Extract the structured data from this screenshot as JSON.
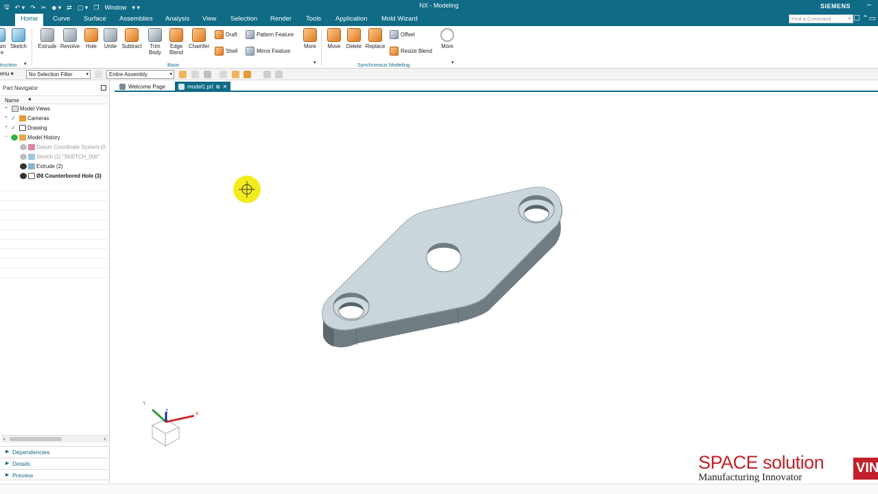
{
  "titlebar": {
    "title": "NX - Modeling",
    "window_label": "Window",
    "brand": "SIEMENS",
    "minimize": "–"
  },
  "menu": {
    "tabs": [
      "Home",
      "Curve",
      "Surface",
      "Assemblies",
      "Analysis",
      "View",
      "Selection",
      "Render",
      "Tools",
      "Application",
      "Mold Wizard"
    ],
    "active": "Home",
    "find_placeholder": "Find a Command"
  },
  "ribbon": {
    "left_partial": [
      "um",
      "e"
    ],
    "sketch": "Sketch",
    "extrude": "Extrude",
    "revolve": "Revolve",
    "hole": "Hole",
    "unite": "Unite",
    "subtract": "Subtract",
    "trim_body": "Trim Body",
    "edge_blend": "Edge Blend",
    "chamfer": "Chamfer",
    "draft": "Draft",
    "shell": "Shell",
    "pattern_feature": "Pattern Feature",
    "mirror_feature": "Mirror Feature",
    "more1": "More",
    "move": "Move",
    "delete": "Delete",
    "replace": "Replace",
    "offset": "Offset",
    "resize_blend": "Resize Blend",
    "more2": "More",
    "group_construction": "truction",
    "group_base": "Base",
    "group_sync": "Synchronous Modeling"
  },
  "selection": {
    "menu": "enu",
    "filter": "No Selection Filter",
    "scope": "Entire Assembly"
  },
  "navigator": {
    "title": "Part Navigator",
    "column_name": "Name",
    "items": [
      {
        "label": "Model Views",
        "style": "normal"
      },
      {
        "label": "Cameras",
        "style": "normal"
      },
      {
        "label": "Drawing",
        "style": "normal"
      },
      {
        "label": "Model History",
        "style": "normal"
      },
      {
        "label": "Datum Coordinate System (0",
        "style": "dim"
      },
      {
        "label": "Sketch (1) \"SKETCH_000\"",
        "style": "dim"
      },
      {
        "label": "Extrude (2)",
        "style": "normal"
      },
      {
        "label": "Ø8 Counterbored Hole (3)",
        "style": "bold"
      }
    ],
    "panels": [
      "Dependencies",
      "Details",
      "Preview"
    ]
  },
  "doc_tabs": {
    "welcome": "Welcome Page",
    "model": "model1.prt"
  },
  "triad": {
    "x": "X",
    "y": "Y",
    "z": "Z"
  },
  "logo": {
    "line1": "SPACE solution",
    "line2": "Manufacturing Innovator",
    "badge": "VIN"
  },
  "colors": {
    "chrome": "#0f6b86",
    "part_top": "#cbd6dc",
    "part_side": "#6f7c82",
    "logo_red": "#c2202a",
    "cursor_yellow": "#f2ec1c"
  }
}
